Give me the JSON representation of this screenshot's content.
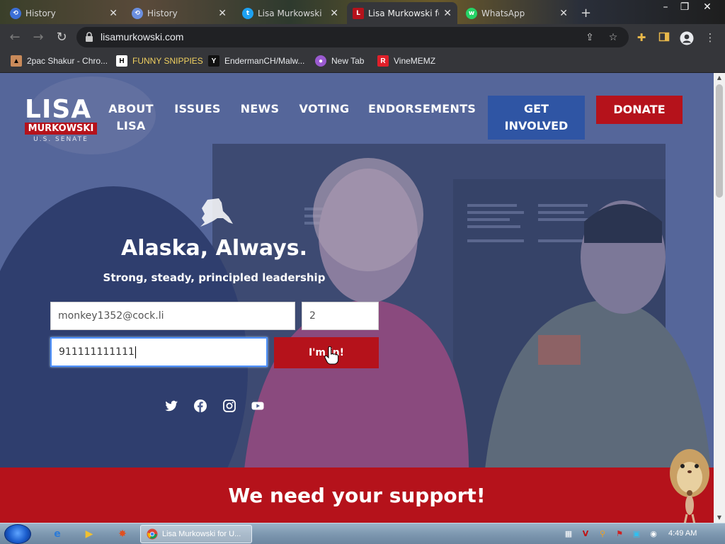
{
  "browser": {
    "tabs": [
      {
        "title": "History",
        "active": false
      },
      {
        "title": "History",
        "active": false
      },
      {
        "title": "Lisa Murkowski",
        "active": false
      },
      {
        "title": "Lisa Murkowski fo",
        "active": true
      },
      {
        "title": "WhatsApp",
        "active": false
      }
    ],
    "new_tab": "+",
    "url": "lisamurkowski.com",
    "bookmarks": [
      {
        "label": "2pac Shakur - Chro..."
      },
      {
        "label": "FUNNY SNIPPIES"
      },
      {
        "label": "EndermanCH/Malw..."
      },
      {
        "label": "New Tab"
      },
      {
        "label": "VineMEMZ"
      }
    ]
  },
  "site": {
    "logo": {
      "name": "LISA",
      "surname": "MURKOWSKI",
      "office": "U.S. SENATE"
    },
    "nav": {
      "about_1": "ABOUT",
      "about_2": "LISA",
      "issues": "ISSUES",
      "news": "NEWS",
      "voting": "VOTING",
      "endorsements": "ENDORSEMENTS",
      "get_involved_1": "GET",
      "get_involved_2": "INVOLVED",
      "donate": "DONATE"
    },
    "hero": {
      "headline": "Alaska, Always.",
      "subhead": "Strong, steady, principled leadership"
    },
    "form": {
      "email_value": "monkey1352@cock.li",
      "zip_value": "2",
      "phone_value": "911111111111",
      "submit_label": "I'm in!"
    },
    "social": [
      "twitter-icon",
      "facebook-icon",
      "instagram-icon",
      "youtube-icon"
    ],
    "support": "We need your support!"
  },
  "taskbar": {
    "chrome_task": "Lisa Murkowski for U...",
    "clock": "4:49 AM"
  }
}
